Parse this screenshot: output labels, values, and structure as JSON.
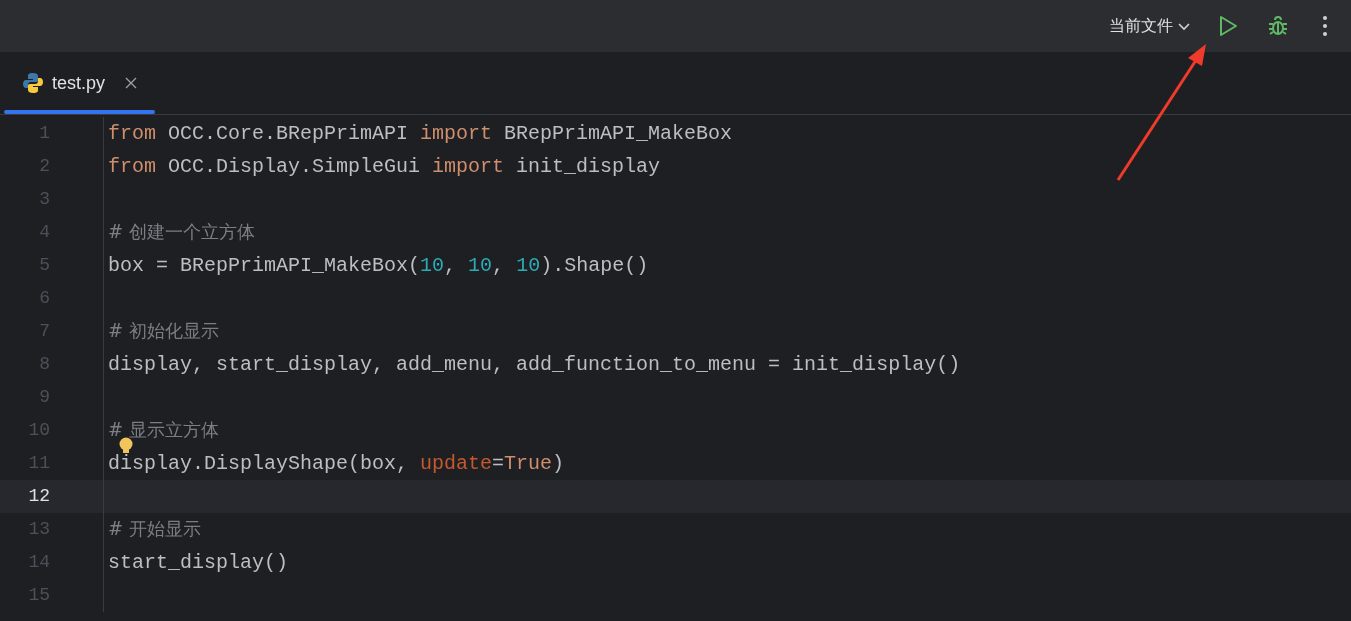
{
  "toolbar": {
    "run_config": "当前文件"
  },
  "tabs": [
    {
      "label": "test.py",
      "selected": true
    }
  ],
  "lines": [
    {
      "number": "1",
      "current": false,
      "tokens": [
        {
          "kind": "keyword",
          "text": "from"
        },
        {
          "kind": "plain",
          "text": " OCC.Core.BRepPrimAPI "
        },
        {
          "kind": "keyword",
          "text": "import"
        },
        {
          "kind": "plain",
          "text": " BRepPrimAPI_MakeBox"
        }
      ]
    },
    {
      "number": "2",
      "current": false,
      "tokens": [
        {
          "kind": "keyword",
          "text": "from"
        },
        {
          "kind": "plain",
          "text": " OCC.Display.SimpleGui "
        },
        {
          "kind": "keyword",
          "text": "import"
        },
        {
          "kind": "plain",
          "text": " init_display"
        }
      ]
    },
    {
      "number": "3",
      "current": false
    },
    {
      "number": "4",
      "current": false,
      "tokens": [
        {
          "kind": "comment",
          "text": "# 创建一个立方体"
        }
      ]
    },
    {
      "number": "5",
      "current": false,
      "tokens": [
        {
          "kind": "plain",
          "text": "box = BRepPrimAPI_MakeBox("
        },
        {
          "kind": "number",
          "text": "10"
        },
        {
          "kind": "plain",
          "text": ", "
        },
        {
          "kind": "number",
          "text": "10"
        },
        {
          "kind": "plain",
          "text": ", "
        },
        {
          "kind": "number",
          "text": "10"
        },
        {
          "kind": "plain",
          "text": ").Shape()"
        }
      ]
    },
    {
      "number": "6",
      "current": false
    },
    {
      "number": "7",
      "current": false,
      "tokens": [
        {
          "kind": "comment",
          "text": "# 初始化显示"
        }
      ]
    },
    {
      "number": "8",
      "current": false,
      "tokens": [
        {
          "kind": "plain",
          "text": "display, start_display, add_menu, add_function_to_menu = init_display()"
        }
      ]
    },
    {
      "number": "9",
      "current": false
    },
    {
      "number": "10",
      "current": false,
      "tokens": [
        {
          "kind": "comment",
          "text": "# 显示立方体"
        }
      ]
    },
    {
      "number": "11",
      "current": false,
      "bulb": true,
      "tokens": [
        {
          "kind": "plain",
          "text": "display.DisplayShape(box, "
        },
        {
          "kind": "param",
          "text": "update"
        },
        {
          "kind": "plain",
          "text": "="
        },
        {
          "kind": "keyword",
          "text": "True"
        },
        {
          "kind": "plain",
          "text": ")"
        }
      ]
    },
    {
      "number": "12",
      "current": true
    },
    {
      "number": "13",
      "current": false,
      "tokens": [
        {
          "kind": "comment",
          "text": "# 开始显示"
        }
      ]
    },
    {
      "number": "14",
      "current": false,
      "tokens": [
        {
          "kind": "plain",
          "text": "start_display()"
        }
      ]
    },
    {
      "number": "15",
      "current": false
    }
  ]
}
